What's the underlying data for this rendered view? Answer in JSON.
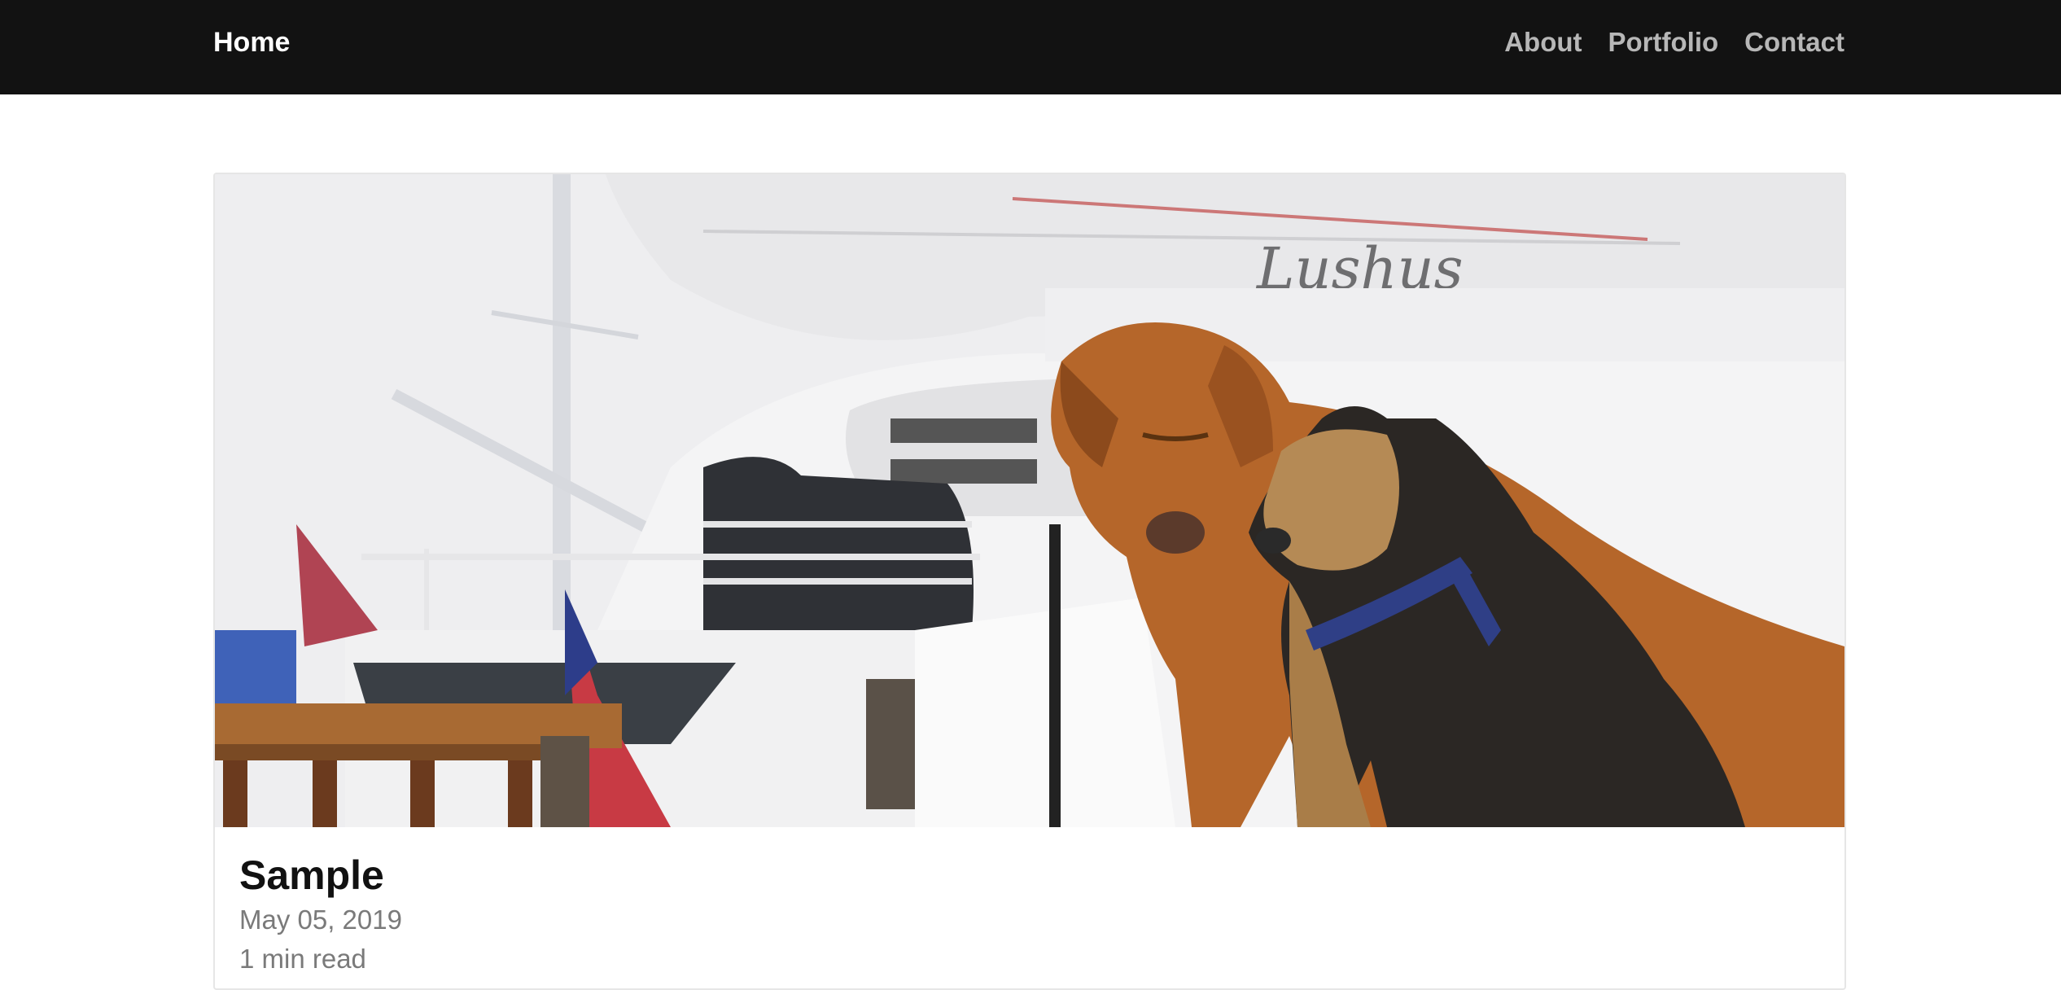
{
  "nav": {
    "brand": "Home",
    "links": [
      {
        "label": "About"
      },
      {
        "label": "Portfolio"
      },
      {
        "label": "Contact"
      }
    ]
  },
  "post": {
    "title": "Sample",
    "date": "May 05, 2019",
    "read_time": "1 min read",
    "image": {
      "subject": "two dogs sitting in front of boats at a marina",
      "boat_name": "Lushus"
    }
  },
  "colors": {
    "navbar_bg": "#121212",
    "brand": "#ffffff",
    "nav_link": "#b7b7b7",
    "title": "#111111",
    "meta": "#7a7a7a"
  }
}
